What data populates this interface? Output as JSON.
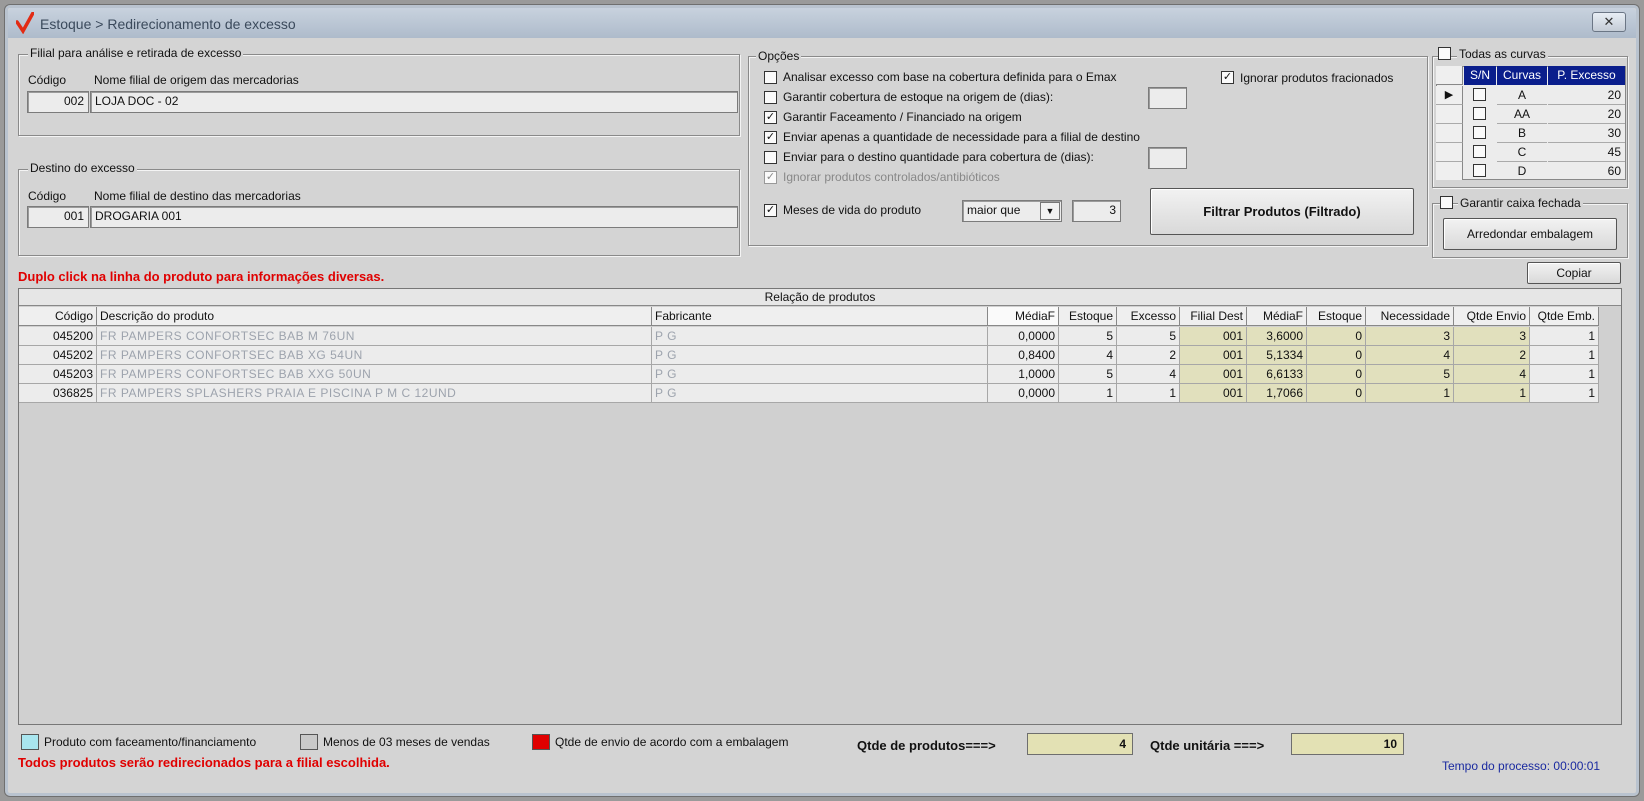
{
  "window": {
    "title": "Estoque > Redirecionamento de excesso",
    "close_label": "✕"
  },
  "origem": {
    "group_title": "Filial para análise e retirada de excesso",
    "codigo_label": "Código",
    "nome_label": "Nome filial de origem das mercadorias",
    "codigo": "002",
    "nome": "LOJA DOC - 02"
  },
  "destino": {
    "group_title": "Destino do excesso",
    "codigo_label": "Código",
    "nome_label": "Nome filial de destino das mercadorias",
    "codigo": "001",
    "nome": "DROGARIA 001"
  },
  "opcoes": {
    "group_title": "Opções",
    "items": [
      {
        "label": "Analisar excesso com base na cobertura definida para o Emax",
        "checked": false,
        "disabled": false
      },
      {
        "label": "Garantir cobertura de estoque na origem de (dias):",
        "checked": false,
        "disabled": false
      },
      {
        "label": "Garantir Faceamento / Financiado na origem",
        "checked": true,
        "disabled": false
      },
      {
        "label": "Enviar apenas a quantidade de necessidade para a filial de destino",
        "checked": true,
        "disabled": false
      },
      {
        "label": "Enviar para o destino quantidade para cobertura de (dias):",
        "checked": false,
        "disabled": false
      },
      {
        "label": "Ignorar produtos controlados/antibióticos",
        "checked": true,
        "disabled": true
      }
    ],
    "ignorar_fracionados": {
      "label": "Ignorar produtos fracionados",
      "checked": true
    },
    "meses_vida": {
      "label": "Meses de vida do produto",
      "checked": true,
      "operator": "maior que",
      "value": "3"
    },
    "filtrar_label": "Filtrar Produtos (Filtrado)"
  },
  "curvas": {
    "todas_label": "Todas as curvas",
    "headers": [
      "S/N",
      "Curvas",
      "P. Excesso"
    ],
    "rows": [
      {
        "curva": "A",
        "excesso": "20"
      },
      {
        "curva": "AA",
        "excesso": "20"
      },
      {
        "curva": "B",
        "excesso": "30"
      },
      {
        "curva": "C",
        "excesso": "45"
      },
      {
        "curva": "D",
        "excesso": "60"
      }
    ],
    "garantir_caixa_label": "Garantir caixa fechada",
    "arredondar_label": "Arredondar embalagem"
  },
  "note_top": "Duplo click na linha do produto para informações diversas.",
  "copiar_label": "Copiar",
  "table": {
    "title": "Relação de produtos",
    "columns": [
      "Código",
      "Descrição do produto",
      "Fabricante",
      "MédiaF",
      "Estoque",
      "Excesso",
      "Filial Dest",
      "MédiaF",
      "Estoque",
      "Necessidade",
      "Qtde Envio",
      "Qtde Emb."
    ],
    "rows": [
      [
        "045200",
        "FR PAMPERS CONFORTSEC BAB M 76UN",
        "P G",
        "0,0000",
        "5",
        "5",
        "001",
        "3,6000",
        "0",
        "3",
        "3",
        "1"
      ],
      [
        "045202",
        "FR PAMPERS CONFORTSEC BAB XG 54UN",
        "P G",
        "0,8400",
        "4",
        "2",
        "001",
        "5,1334",
        "0",
        "4",
        "2",
        "1"
      ],
      [
        "045203",
        "FR PAMPERS CONFORTSEC BAB XXG 50UN",
        "P G",
        "1,0000",
        "5",
        "4",
        "001",
        "6,6133",
        "0",
        "5",
        "4",
        "1"
      ],
      [
        "036825",
        "FR PAMPERS SPLASHERS PRAIA E PISCINA P M C 12UND",
        "P G",
        "0,0000",
        "1",
        "1",
        "001",
        "1,7066",
        "0",
        "1",
        "1",
        "1"
      ]
    ]
  },
  "legend": [
    {
      "label": "Produto com faceamento/financiamento",
      "color": "#a9e6ef"
    },
    {
      "label": "Menos de 03 meses de vendas",
      "color": "#c9c9c9"
    },
    {
      "label": "Qtde de envio de acordo com a embalagem",
      "color": "#e00000"
    }
  ],
  "totals": {
    "produtos_label": "Qtde de produtos===>",
    "produtos_value": "4",
    "unitaria_label": "Qtde unitária ===>",
    "unitaria_value": "10"
  },
  "note_bottom": "Todos produtos serão redirecionados para a filial escolhida.",
  "tempo": "Tempo do processo: 00:00:01"
}
